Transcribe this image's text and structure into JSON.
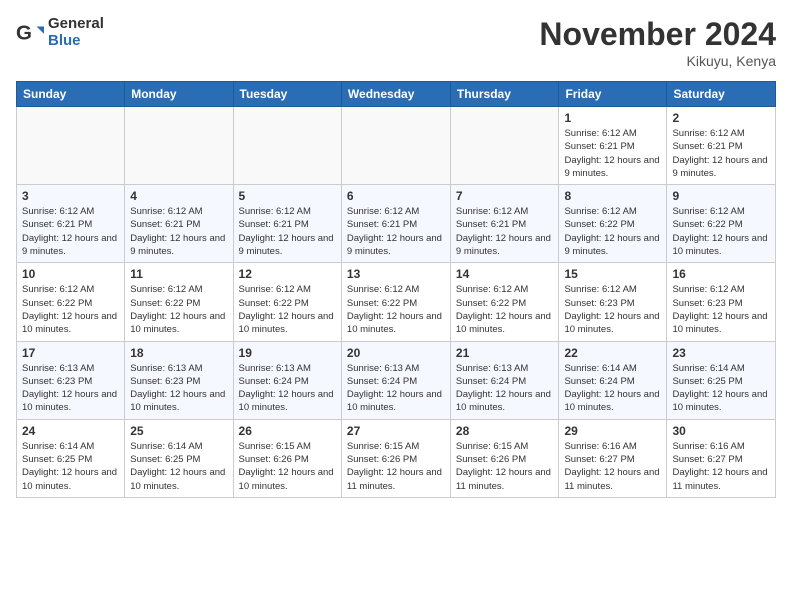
{
  "logo": {
    "general": "General",
    "blue": "Blue"
  },
  "title": "November 2024",
  "location": "Kikuyu, Kenya",
  "days_of_week": [
    "Sunday",
    "Monday",
    "Tuesday",
    "Wednesday",
    "Thursday",
    "Friday",
    "Saturday"
  ],
  "weeks": [
    [
      {
        "day": "",
        "info": ""
      },
      {
        "day": "",
        "info": ""
      },
      {
        "day": "",
        "info": ""
      },
      {
        "day": "",
        "info": ""
      },
      {
        "day": "",
        "info": ""
      },
      {
        "day": "1",
        "info": "Sunrise: 6:12 AM\nSunset: 6:21 PM\nDaylight: 12 hours and 9 minutes."
      },
      {
        "day": "2",
        "info": "Sunrise: 6:12 AM\nSunset: 6:21 PM\nDaylight: 12 hours and 9 minutes."
      }
    ],
    [
      {
        "day": "3",
        "info": "Sunrise: 6:12 AM\nSunset: 6:21 PM\nDaylight: 12 hours and 9 minutes."
      },
      {
        "day": "4",
        "info": "Sunrise: 6:12 AM\nSunset: 6:21 PM\nDaylight: 12 hours and 9 minutes."
      },
      {
        "day": "5",
        "info": "Sunrise: 6:12 AM\nSunset: 6:21 PM\nDaylight: 12 hours and 9 minutes."
      },
      {
        "day": "6",
        "info": "Sunrise: 6:12 AM\nSunset: 6:21 PM\nDaylight: 12 hours and 9 minutes."
      },
      {
        "day": "7",
        "info": "Sunrise: 6:12 AM\nSunset: 6:21 PM\nDaylight: 12 hours and 9 minutes."
      },
      {
        "day": "8",
        "info": "Sunrise: 6:12 AM\nSunset: 6:22 PM\nDaylight: 12 hours and 9 minutes."
      },
      {
        "day": "9",
        "info": "Sunrise: 6:12 AM\nSunset: 6:22 PM\nDaylight: 12 hours and 10 minutes."
      }
    ],
    [
      {
        "day": "10",
        "info": "Sunrise: 6:12 AM\nSunset: 6:22 PM\nDaylight: 12 hours and 10 minutes."
      },
      {
        "day": "11",
        "info": "Sunrise: 6:12 AM\nSunset: 6:22 PM\nDaylight: 12 hours and 10 minutes."
      },
      {
        "day": "12",
        "info": "Sunrise: 6:12 AM\nSunset: 6:22 PM\nDaylight: 12 hours and 10 minutes."
      },
      {
        "day": "13",
        "info": "Sunrise: 6:12 AM\nSunset: 6:22 PM\nDaylight: 12 hours and 10 minutes."
      },
      {
        "day": "14",
        "info": "Sunrise: 6:12 AM\nSunset: 6:22 PM\nDaylight: 12 hours and 10 minutes."
      },
      {
        "day": "15",
        "info": "Sunrise: 6:12 AM\nSunset: 6:23 PM\nDaylight: 12 hours and 10 minutes."
      },
      {
        "day": "16",
        "info": "Sunrise: 6:12 AM\nSunset: 6:23 PM\nDaylight: 12 hours and 10 minutes."
      }
    ],
    [
      {
        "day": "17",
        "info": "Sunrise: 6:13 AM\nSunset: 6:23 PM\nDaylight: 12 hours and 10 minutes."
      },
      {
        "day": "18",
        "info": "Sunrise: 6:13 AM\nSunset: 6:23 PM\nDaylight: 12 hours and 10 minutes."
      },
      {
        "day": "19",
        "info": "Sunrise: 6:13 AM\nSunset: 6:24 PM\nDaylight: 12 hours and 10 minutes."
      },
      {
        "day": "20",
        "info": "Sunrise: 6:13 AM\nSunset: 6:24 PM\nDaylight: 12 hours and 10 minutes."
      },
      {
        "day": "21",
        "info": "Sunrise: 6:13 AM\nSunset: 6:24 PM\nDaylight: 12 hours and 10 minutes."
      },
      {
        "day": "22",
        "info": "Sunrise: 6:14 AM\nSunset: 6:24 PM\nDaylight: 12 hours and 10 minutes."
      },
      {
        "day": "23",
        "info": "Sunrise: 6:14 AM\nSunset: 6:25 PM\nDaylight: 12 hours and 10 minutes."
      }
    ],
    [
      {
        "day": "24",
        "info": "Sunrise: 6:14 AM\nSunset: 6:25 PM\nDaylight: 12 hours and 10 minutes."
      },
      {
        "day": "25",
        "info": "Sunrise: 6:14 AM\nSunset: 6:25 PM\nDaylight: 12 hours and 10 minutes."
      },
      {
        "day": "26",
        "info": "Sunrise: 6:15 AM\nSunset: 6:26 PM\nDaylight: 12 hours and 10 minutes."
      },
      {
        "day": "27",
        "info": "Sunrise: 6:15 AM\nSunset: 6:26 PM\nDaylight: 12 hours and 11 minutes."
      },
      {
        "day": "28",
        "info": "Sunrise: 6:15 AM\nSunset: 6:26 PM\nDaylight: 12 hours and 11 minutes."
      },
      {
        "day": "29",
        "info": "Sunrise: 6:16 AM\nSunset: 6:27 PM\nDaylight: 12 hours and 11 minutes."
      },
      {
        "day": "30",
        "info": "Sunrise: 6:16 AM\nSunset: 6:27 PM\nDaylight: 12 hours and 11 minutes."
      }
    ]
  ]
}
